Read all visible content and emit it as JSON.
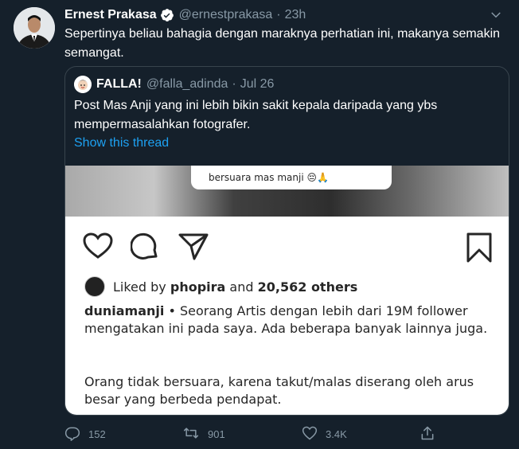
{
  "tweet": {
    "author_name": "Ernest Prakasa",
    "author_handle": "@ernestprakasa",
    "separator": "·",
    "time": "23h",
    "text": "Sepertinya beliau bahagia dengan maraknya perhatian ini, makanya semakin semangat."
  },
  "quote": {
    "author_name": "FALLA!",
    "author_handle": "@falla_adinda",
    "separator": "·",
    "date": "Jul 26",
    "text": "Post Mas Anji yang ini lebih bikin sakit kepala daripada yang ybs mempermasalahkan fotografer.",
    "show_thread_label": "Show this thread",
    "media": {
      "comment_text": "bersuara mas manji 😔🙏",
      "liked_by_prefix": "Liked by",
      "liked_by_user": "phopira",
      "liked_by_and": "and",
      "liked_by_count": "20,562 others",
      "caption_user": "duniamanji",
      "caption_text": "• Seorang Artis dengan lebih dari 19M follower mengatakan ini pada saya. Ada beberapa banyak lainnya juga.",
      "caption_text_2": "Orang tidak bersuara, karena takut/malas diserang oleh arus besar yang berbeda pendapat."
    }
  },
  "actions": {
    "reply_count": "152",
    "retweet_count": "901",
    "like_count": "3.4K"
  },
  "colors": {
    "background": "#15202b",
    "accent": "#1da1f2",
    "muted": "#8899a6"
  }
}
